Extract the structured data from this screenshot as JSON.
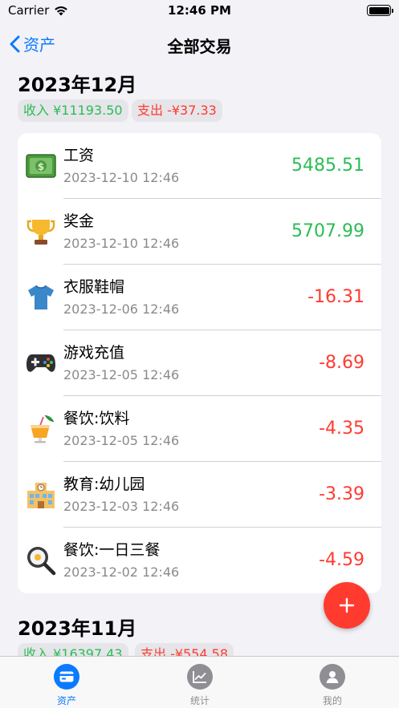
{
  "status_bar": {
    "carrier": "Carrier",
    "time": "12:46 PM"
  },
  "nav": {
    "back_label": "资产",
    "title": "全部交易"
  },
  "months": [
    {
      "title": "2023年12月",
      "income": "收入 ¥11193.50",
      "expense": "支出 -¥37.33",
      "transactions": [
        {
          "icon": "money-icon",
          "name": "工资",
          "date": "2023-12-10 12:46",
          "amount": "5485.51",
          "kind": "income"
        },
        {
          "icon": "trophy-icon",
          "name": "奖金",
          "date": "2023-12-10 12:46",
          "amount": "5707.99",
          "kind": "income"
        },
        {
          "icon": "tshirt-icon",
          "name": "衣服鞋帽",
          "date": "2023-12-06 12:46",
          "amount": "-16.31",
          "kind": "expense"
        },
        {
          "icon": "gamepad-icon",
          "name": "游戏充值",
          "date": "2023-12-05 12:46",
          "amount": "-8.69",
          "kind": "expense"
        },
        {
          "icon": "drink-icon",
          "name": "餐饮:饮料",
          "date": "2023-12-05 12:46",
          "amount": "-4.35",
          "kind": "expense"
        },
        {
          "icon": "school-icon",
          "name": "教育:幼儿园",
          "date": "2023-12-03 12:46",
          "amount": "-3.39",
          "kind": "expense"
        },
        {
          "icon": "frying-pan-icon",
          "name": "餐饮:一日三餐",
          "date": "2023-12-02 12:46",
          "amount": "-4.59",
          "kind": "expense"
        }
      ]
    },
    {
      "title": "2023年11月",
      "income": "收入 ¥16397.43",
      "expense": "支出 -¥554.58"
    }
  ],
  "tabs": [
    {
      "label": "资产",
      "icon": "card-icon",
      "active": true
    },
    {
      "label": "统计",
      "icon": "chart-icon",
      "active": false
    },
    {
      "label": "我的",
      "icon": "person-icon",
      "active": false
    }
  ],
  "colors": {
    "accent": "#0a7aff",
    "income": "#2bbd55",
    "expense": "#ff3b30",
    "fab": "#ff3b30",
    "tab_inactive": "#8e8e93"
  }
}
